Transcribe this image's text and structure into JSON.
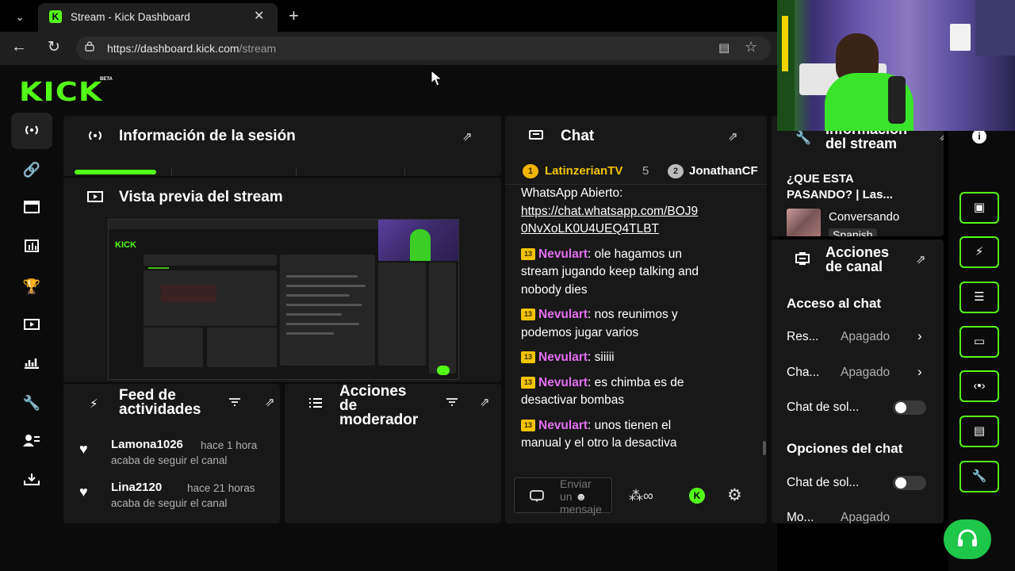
{
  "browser": {
    "tab_title": "Stream - Kick Dashboard",
    "tab_favicon": "K",
    "url_host": "https://dashboard.kick.com",
    "url_path": "/stream"
  },
  "logo": {
    "text": "KICK",
    "badge": "BETA"
  },
  "panels": {
    "session": {
      "title": "Información de la sesión"
    },
    "preview": {
      "title": "Vista previa del stream"
    },
    "feed": {
      "title_line1": "Feed de",
      "title_line2": "actividades",
      "items": [
        {
          "user": "Lamona1026",
          "time": "hace 1 hora",
          "action": "acaba de seguir el canal"
        },
        {
          "user": "Lina2120",
          "time": "hace 21 horas",
          "action": "acaba de seguir el canal"
        }
      ]
    },
    "mod": {
      "title_line1": "Acciones",
      "title_line2": "de",
      "title_line3": "moderador"
    },
    "chat": {
      "title": "Chat",
      "top_chatters": [
        {
          "rank": "1",
          "name": "LatinzerianTV",
          "count": "5"
        },
        {
          "rank": "2",
          "name": "JonathanCF"
        }
      ],
      "pinned_text": "WhatsApp Abierto:",
      "link_line1": "https://chat.whatsapp.com/BOJ9",
      "link_line2": "0NvXoLK0U4UEQ4TLBT",
      "messages": [
        {
          "badge": "13",
          "user": "Nevulart",
          "text_line1": ": ole hagamos un",
          "text_line2": "stream jugando keep talking and",
          "text_line3": "nobody dies"
        },
        {
          "badge": "13",
          "user": "Nevulart",
          "text_line1": ": nos reunimos y",
          "text_line2": "podemos jugar varios"
        },
        {
          "badge": "13",
          "user": "Nevulart",
          "text_line1": ": siiiii"
        },
        {
          "badge": "13",
          "user": "Nevulart",
          "text_line1": ": es chimba es de",
          "text_line2": "desactivar bombas"
        },
        {
          "badge": "13",
          "user": "Nevulart",
          "text_line1": ": unos tienen el",
          "text_line2": "manual y el otro la desactiva"
        }
      ],
      "input_placeholder_line1": "Enviar",
      "input_placeholder_line2": "un",
      "input_placeholder_line3": "mensaje"
    },
    "stream_info": {
      "title_line1": "Información",
      "title_line2": "del stream",
      "stream_title_line1": "¿QUE ESTA",
      "stream_title_line2": "PASANDO? | Las...",
      "category": "Conversando",
      "language": "Spanish"
    },
    "channel_actions": {
      "title_line1": "Acciones",
      "title_line2": "de canal",
      "section_chat_access": "Acceso al chat",
      "rows": [
        {
          "label": "Res...",
          "value": "Apagado"
        },
        {
          "label": "Cha...",
          "value": "Apagado"
        }
      ],
      "toggle1_label": "Chat de sol...",
      "section_chat_options": "Opciones del chat",
      "toggle2_label": "Chat de sol...",
      "row_cut_label": "Mo...",
      "row_cut_value": "Apagado"
    }
  },
  "accent_color": "#53fc18"
}
